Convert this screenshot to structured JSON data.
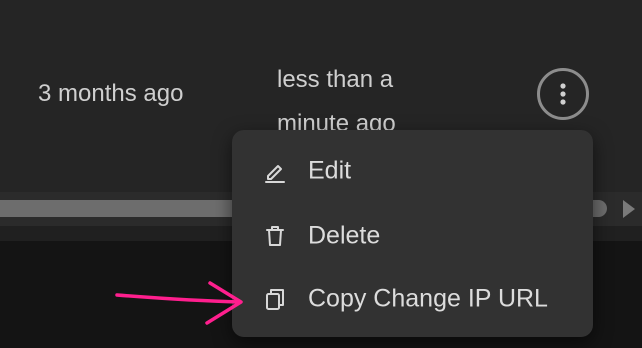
{
  "table": {
    "created": "3 months ago",
    "updated": "less than a minute ago"
  },
  "row_actions": {
    "icon": "more-vertical-icon"
  },
  "menu": {
    "items": [
      {
        "label": "Edit",
        "icon": "edit-pencil-icon"
      },
      {
        "label": "Delete",
        "icon": "trash-icon"
      },
      {
        "label": "Copy Change IP URL",
        "icon": "copy-icon"
      }
    ]
  },
  "colors": {
    "background": "#252525",
    "menu_background": "#323232",
    "text": "#dcdcdc",
    "annotation": "#ff1f8e"
  }
}
